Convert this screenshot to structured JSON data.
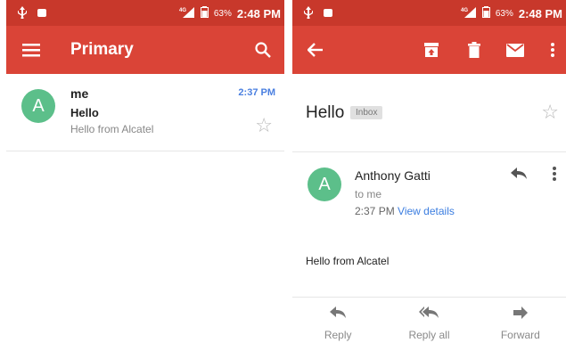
{
  "status": {
    "battery": "63%",
    "time": "2:48 PM",
    "signal_label": "4G"
  },
  "list": {
    "title": "Primary",
    "emails": [
      {
        "avatar_letter": "A",
        "sender": "me",
        "subject": "Hello",
        "snippet": "Hello from Alcatel",
        "time": "2:37 PM"
      }
    ]
  },
  "detail": {
    "subject": "Hello",
    "label": "Inbox",
    "avatar_letter": "A",
    "from": "Anthony Gatti",
    "to": "to me",
    "time": "2:37 PM",
    "view_details": "View details",
    "body": "Hello from Alcatel",
    "actions": {
      "reply": "Reply",
      "reply_all": "Reply all",
      "forward": "Forward"
    }
  },
  "colors": {
    "status_bar": "#c8382b",
    "toolbar": "#da4437",
    "avatar": "#5cbf8a",
    "time_accent": "#4a7fe0",
    "link": "#3b7de0"
  },
  "icons": {
    "menu": "hamburger-menu-icon",
    "search": "search-icon",
    "back": "back-arrow-icon",
    "archive": "archive-icon",
    "delete": "trash-icon",
    "mark_unread": "mail-icon",
    "more": "more-vert-icon",
    "star": "star-outline-icon",
    "reply": "reply-icon",
    "reply_all": "reply-all-icon",
    "forward": "forward-icon"
  }
}
